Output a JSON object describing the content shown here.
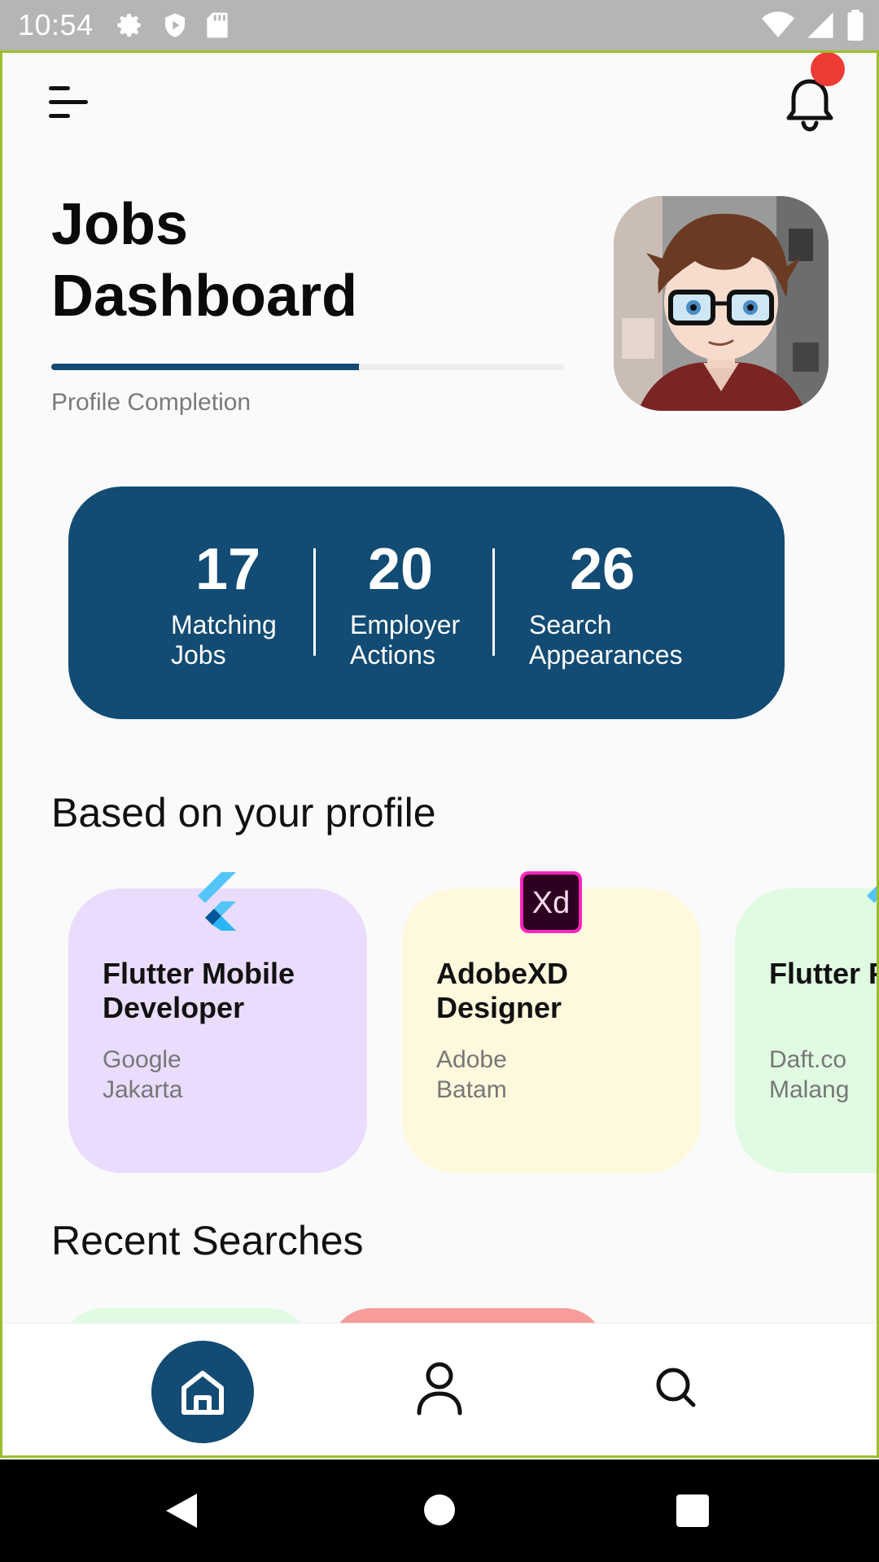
{
  "status_bar": {
    "time": "10:54",
    "icons": [
      "gear-icon",
      "shield-icon",
      "sd-card-icon",
      "wifi-icon",
      "signal-icon",
      "battery-icon"
    ]
  },
  "header": {
    "title_line1": "Jobs",
    "title_line2": "Dashboard",
    "has_notification": true
  },
  "profile": {
    "completion_label": "Profile Completion",
    "completion_fraction": 0.6
  },
  "stats": [
    {
      "value": "17",
      "label_line1": "Matching",
      "label_line2": "Jobs"
    },
    {
      "value": "20",
      "label_line1": "Employer",
      "label_line2": "Actions"
    },
    {
      "value": "26",
      "label_line1": "Search",
      "label_line2": "Appearances"
    }
  ],
  "sections": {
    "recommended": "Based on your profile",
    "recent": "Recent Searches"
  },
  "jobs": [
    {
      "title": "Flutter Mobile Developer",
      "company": "Google",
      "location": "Jakarta",
      "icon": "flutter-icon",
      "color": "#eadcfd"
    },
    {
      "title": "AdobeXD Designer",
      "company": "Adobe",
      "location": "Batam",
      "icon": "adobe-xd-icon",
      "color": "#fef8dd"
    },
    {
      "title": "Flutter F Develop",
      "company": "Daft.co",
      "location": "Malang",
      "icon": "flutter-icon",
      "color": "#e0fbe2"
    }
  ],
  "colors": {
    "primary": "#124b73",
    "notification": "#ee3b34",
    "recent_card_1": "#e0fbe2",
    "recent_card_2": "#f89b9b"
  },
  "bottom_nav": [
    "home-icon",
    "profile-icon",
    "search-icon"
  ]
}
